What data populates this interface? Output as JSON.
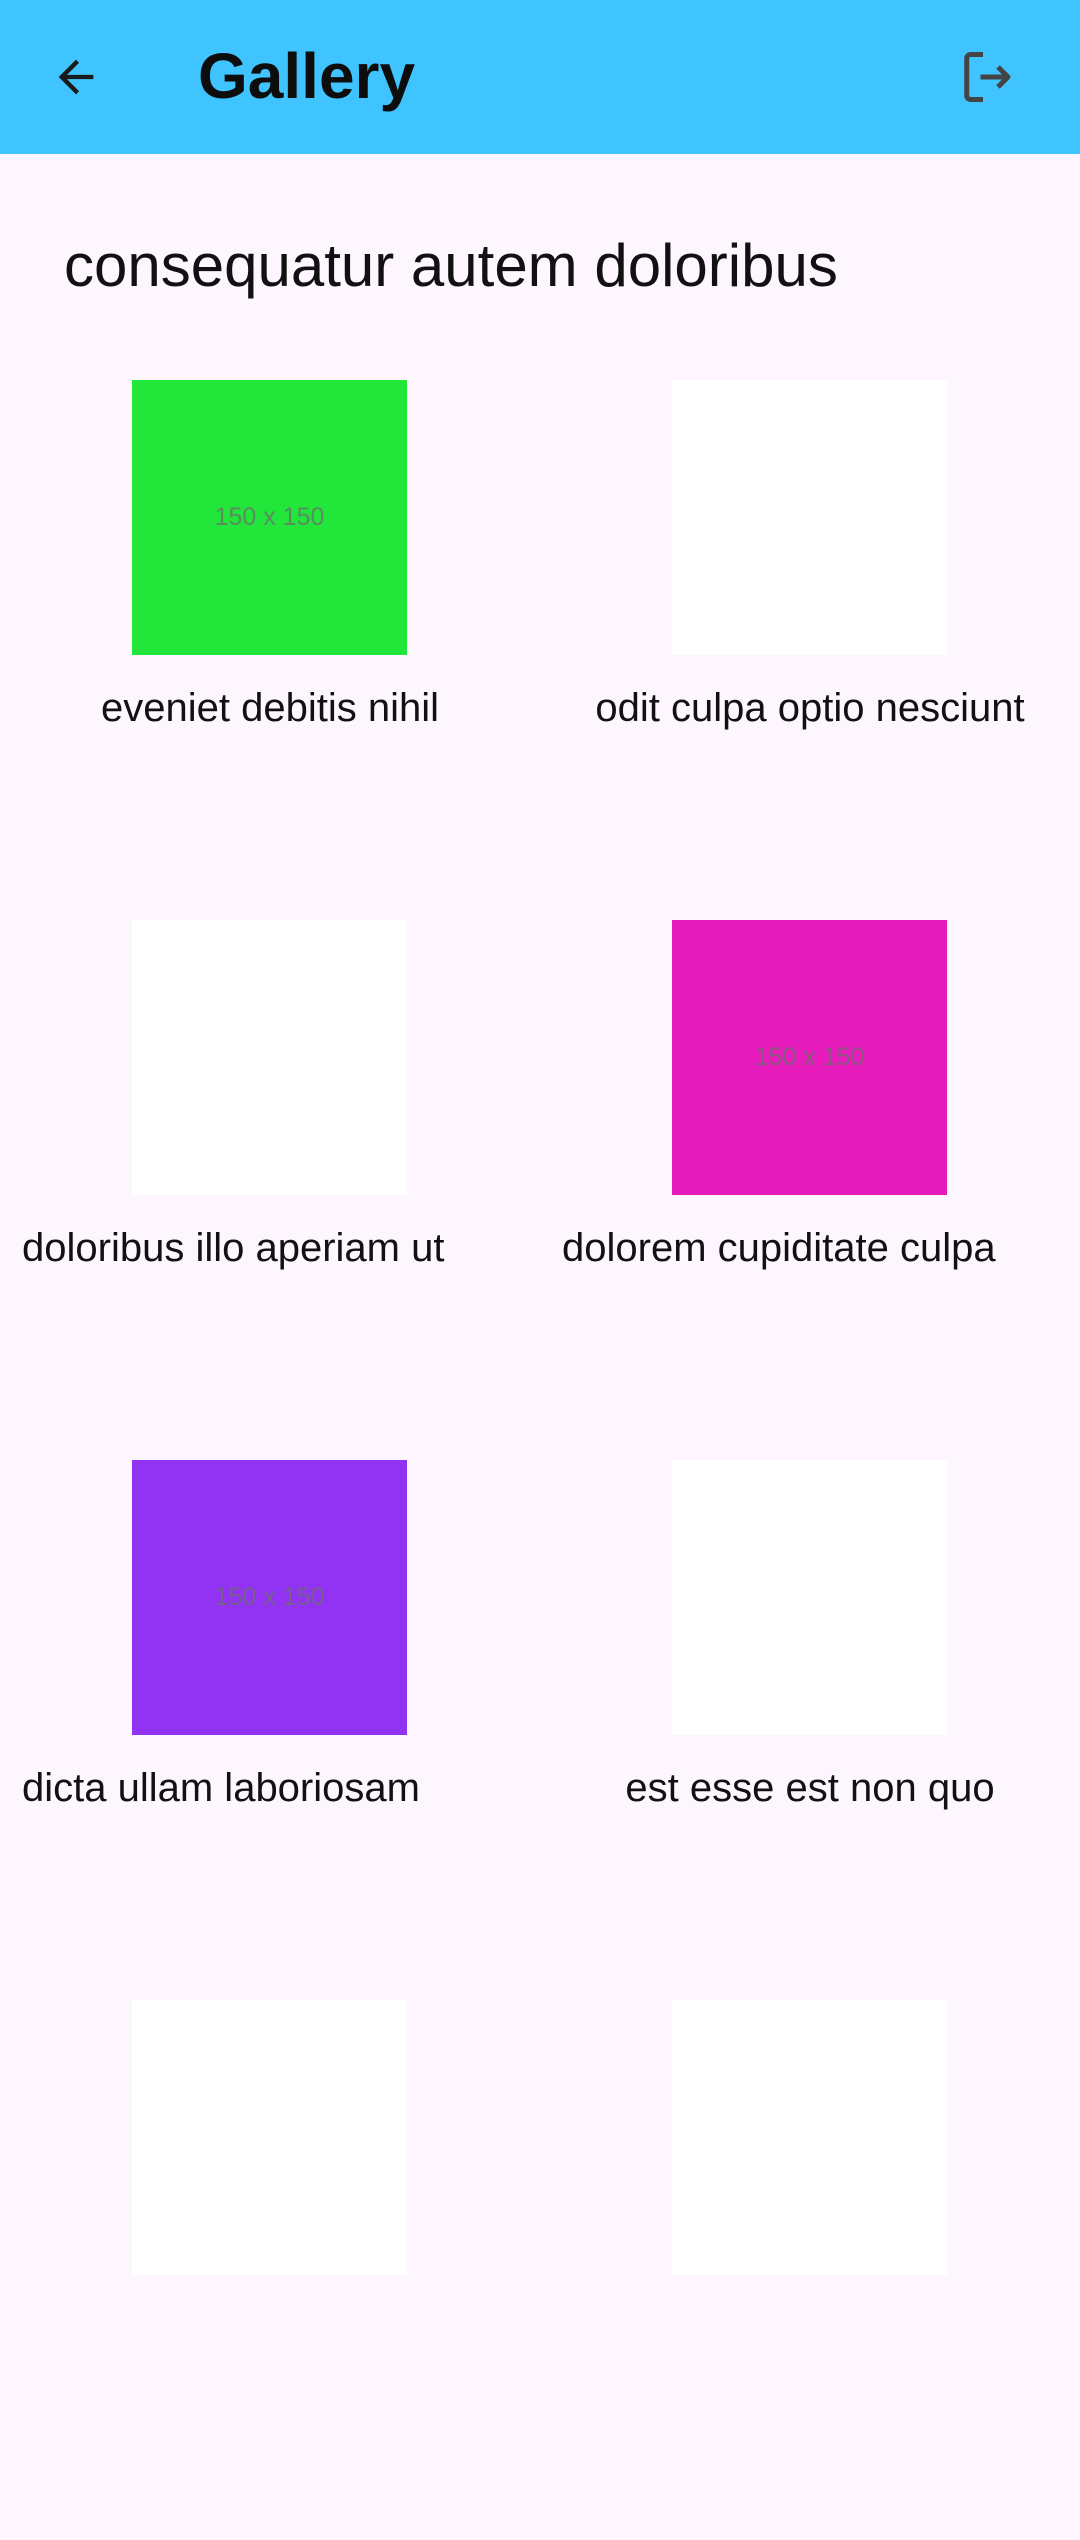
{
  "app_bar": {
    "title": "Gallery",
    "back_icon": "arrow-back-icon",
    "logout_icon": "logout-icon",
    "background": "#40c4ff"
  },
  "album": {
    "title": "consequatur autem doloribus"
  },
  "photos": [
    {
      "caption": "eveniet debitis nihil",
      "placeholder": "150 x 150",
      "color": "#22e63a"
    },
    {
      "caption": "odit culpa optio nesciunt",
      "placeholder": "",
      "color": "#ffffff"
    },
    {
      "caption": "doloribus illo aperiam ut",
      "placeholder": "",
      "color": "#ffffff"
    },
    {
      "caption": "dolorem cupiditate culpa",
      "placeholder": "150 x 150",
      "color": "#e61bbb"
    },
    {
      "caption": "dicta ullam laboriosam",
      "placeholder": "150 x 150",
      "color": "#9232f2"
    },
    {
      "caption": "est esse est non quo",
      "placeholder": "",
      "color": "#ffffff"
    },
    {
      "caption": "",
      "placeholder": "",
      "color": "#ffffff"
    },
    {
      "caption": "",
      "placeholder": "",
      "color": "#ffffff"
    }
  ]
}
